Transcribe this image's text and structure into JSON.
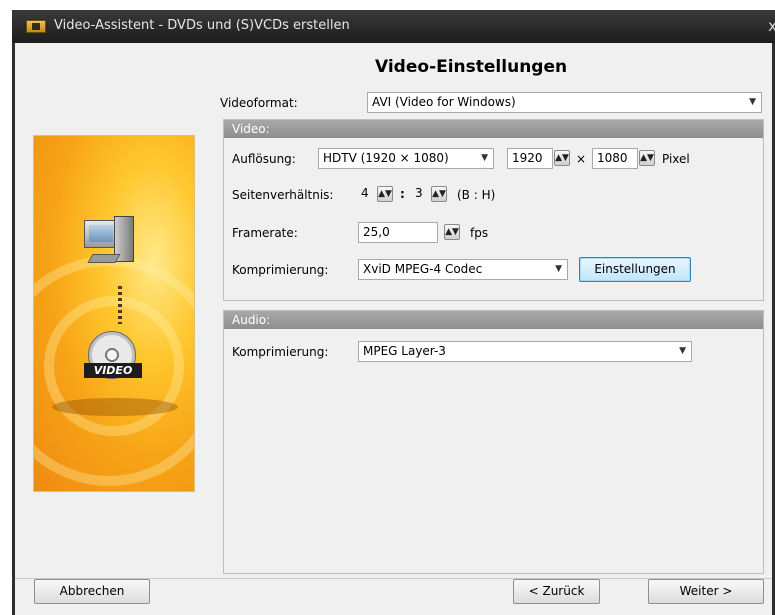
{
  "window": {
    "title": "Video-Assistent - DVDs und (S)VCDs erstellen",
    "close_glyph": "x"
  },
  "heading": "Video-Einstellungen",
  "side_image": {
    "badge": "VIDEO"
  },
  "videoformat": {
    "label": "Videoformat:",
    "value": "AVI (Video for Windows)"
  },
  "video_group": {
    "header": "Video:",
    "resolution": {
      "label": "Auflösung:",
      "preset": "HDTV (1920 × 1080)",
      "width": "1920",
      "times": "×",
      "height": "1080",
      "unit": "Pixel"
    },
    "aspect": {
      "label": "Seitenverhältnis:",
      "w": "4",
      "separator": ":",
      "h": "3",
      "hint": "(B : H)"
    },
    "framerate": {
      "label": "Framerate:",
      "value": "25,0",
      "unit": "fps"
    },
    "compression": {
      "label": "Komprimierung:",
      "value": "XviD MPEG-4 Codec",
      "settings_button": "Einstellungen"
    }
  },
  "audio_group": {
    "header": "Audio:",
    "compression": {
      "label": "Komprimierung:",
      "value": "MPEG Layer-3"
    }
  },
  "buttons": {
    "cancel": "Abbrechen",
    "back": "< Zurück",
    "next": "Weiter >"
  },
  "glyphs": {
    "dropdown": "▼",
    "spin": "▲▼"
  }
}
